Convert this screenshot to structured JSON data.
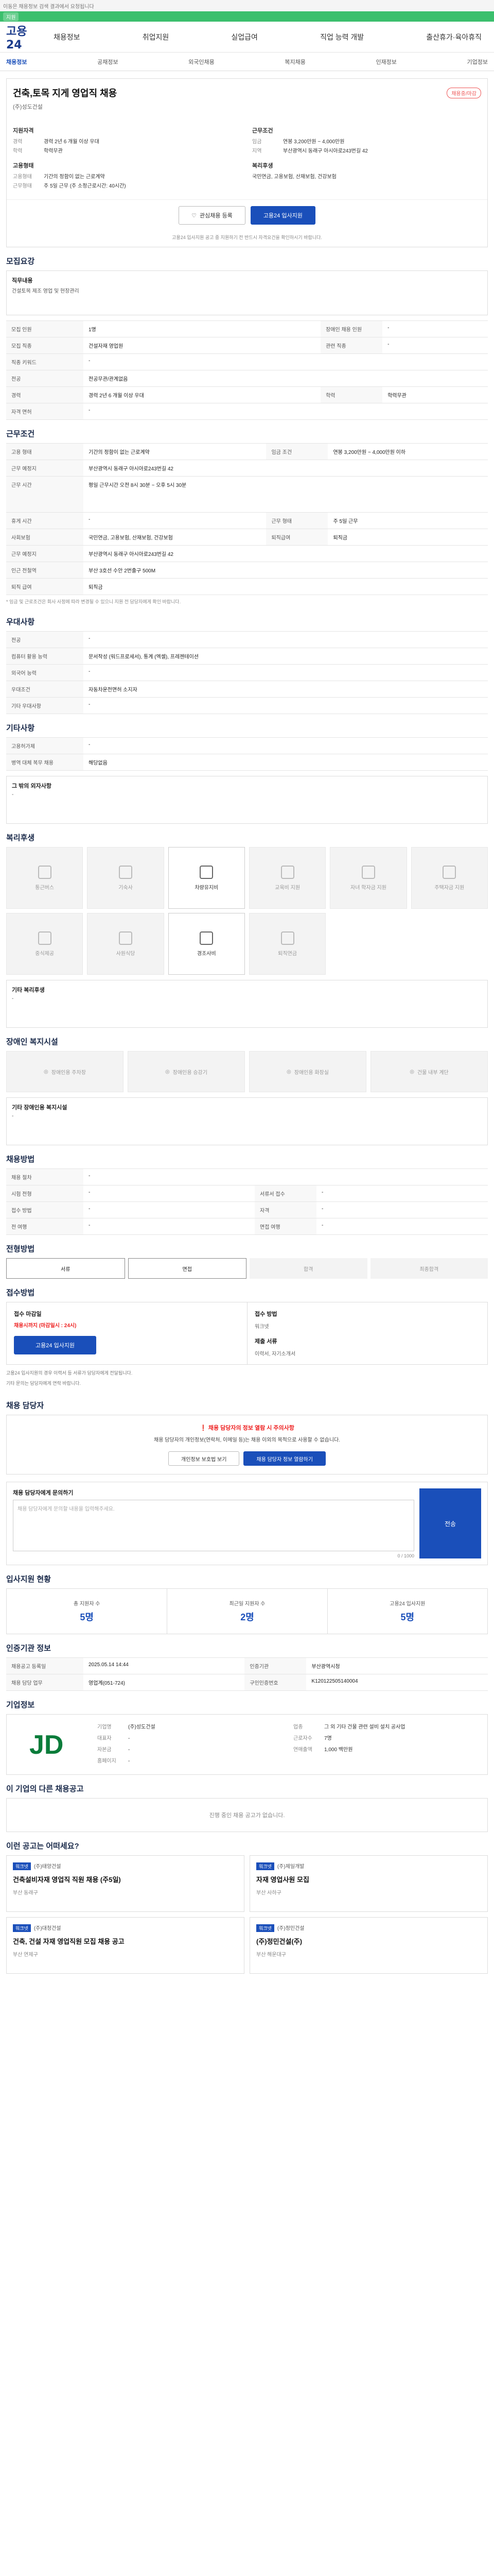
{
  "strip": {
    "text": "이동은 채용정보 검색 결과에서 요청됩니다",
    "active": "지원"
  },
  "header": {
    "logo": "고용24",
    "gnb": [
      "채용정보",
      "취업지원",
      "실업급여",
      "직업 능력 개발",
      "출산휴가·육아휴직"
    ]
  },
  "subnav": [
    "채용정보",
    "공채정보",
    "외국인채용",
    "복지채용",
    "인재정보",
    "기업정보"
  ],
  "job": {
    "title": "건축,토목 지게 영업직 채용",
    "badge": "채용중/마감",
    "company": "(주)성도건설",
    "summary_left_title": "지원자격",
    "summary_left": [
      {
        "k": "경력",
        "v": "경력 2년 6 개월 이상 우대"
      },
      {
        "k": "학력",
        "v": "학력무관"
      }
    ],
    "summary_right_title": "근무조건",
    "summary_right": [
      {
        "k": "임금",
        "v": "연봉 3,200만원 ~ 4,000만원"
      },
      {
        "k": "지역",
        "v": "부산광역시 동래구 아시아로243번길 42"
      }
    ],
    "summary_left2_title": "고용형태",
    "summary_left2": [
      {
        "k": "고용형태",
        "v": "기간의 정함이 없는 근로계약"
      },
      {
        "k": "근무형태",
        "v": "주 5일 근무 (주 소정근로시간: 40시간)"
      }
    ],
    "summary_right2_title": "복리후생",
    "summary_right2": [
      {
        "k": "",
        "v": "국민연금, 고용보험, 산재보험, 건강보험"
      }
    ],
    "btn_save": "관심채용 등록",
    "btn_apply": "고용24 입사지원",
    "apply_note": "고용24 입사지원 공고 중 지원하기 전 반드시 자격요건을 확인하시기 바랍니다."
  },
  "recruit": {
    "title": "모집요강",
    "job_label": "직무내용",
    "job_text": "건설토목 제조 영업 및 현장관리",
    "rows": [
      {
        "k": "모집 인원",
        "v": "1명",
        "k2": "장애인 채용 인원",
        "v2": "-"
      },
      {
        "k": "모집 직종",
        "v": "건설자재 영업원",
        "k2": "관련 직종",
        "v2": "-"
      },
      {
        "k": "직종 키워드",
        "v": "-",
        "k2": "",
        "v2": ""
      },
      {
        "k": "전공",
        "v": "전공무관/관계없음",
        "k2": "",
        "v2": ""
      },
      {
        "k": "경력",
        "v": "경력 2년 6 개월 이상 우대",
        "k2": "학력",
        "v2": "학력무관"
      },
      {
        "k": "자격 면허",
        "v": "-",
        "k2": "",
        "v2": ""
      }
    ]
  },
  "conditions": {
    "title": "근무조건",
    "rows": [
      {
        "k": "고용 형태",
        "v": "기간의 정함이 없는 근로계약",
        "k2": "임금 조건",
        "v2": "연봉 3,200만원 ~ 4,000만원 이하"
      },
      {
        "k": "근무 예정지",
        "v": "부산광역시 동래구 아시아로243번길 42",
        "k2": "",
        "v2": ""
      },
      {
        "k": "근무 시간",
        "v": "평일 근무시간 오전 8시 30분 ~ 오후 5시 30분",
        "k2": "",
        "v2": ""
      },
      {
        "k": "휴게 시간",
        "v": "-",
        "k2": "근무 형태",
        "v2": "주 5일 근무"
      },
      {
        "k": "사회보험",
        "v": "국민연금, 고용보험, 산재보험, 건강보험",
        "k2": "퇴직급여",
        "v2": "퇴직금"
      },
      {
        "k": "근무 예정지",
        "v": "부산광역시 동래구 아시아로243번길 42",
        "k2": "",
        "v2": ""
      },
      {
        "k": "인근 전철역",
        "v": "부산 3호선 수안 2번출구 500M",
        "k2": "",
        "v2": ""
      },
      {
        "k": "퇴직 급여",
        "v": "퇴직금",
        "k2": "",
        "v2": ""
      }
    ],
    "note": "* 임금 및 근로조건은 회사 사정에 따라 변경될 수 있으니 지원 전 담당자에게 확인 바랍니다."
  },
  "prefer": {
    "title": "우대사항",
    "rows": [
      {
        "k": "전공",
        "v": "-"
      },
      {
        "k": "컴퓨터 활용 능력",
        "v": "문서작성 (워드프로세서), 통계 (엑셀), 프레젠테이션"
      },
      {
        "k": "외국어 능력",
        "v": "-"
      },
      {
        "k": "우대조건",
        "v": "자동차운전면허 소지자"
      },
      {
        "k": "기타 우대사항",
        "v": "-"
      }
    ]
  },
  "etc": {
    "title": "기타사항",
    "rows": [
      {
        "k": "고용허가제",
        "v": "-"
      },
      {
        "k": "병역 대체 복무 채용",
        "v": "해당없음"
      }
    ],
    "extra_label": "그 밖의 외자사항",
    "extra_value": "-"
  },
  "welfare": {
    "title": "복리후생",
    "items": [
      {
        "label": "통근버스",
        "on": false
      },
      {
        "label": "기숙사",
        "on": false
      },
      {
        "label": "차량유지비",
        "on": true
      },
      {
        "label": "교육비 지원",
        "on": false
      },
      {
        "label": "자녀 학자금 지원",
        "on": false
      },
      {
        "label": "주택자금 지원",
        "on": false
      },
      {
        "label": "중식제공",
        "on": false
      },
      {
        "label": "사원식당",
        "on": false
      },
      {
        "label": "경조사비",
        "on": true
      },
      {
        "label": "퇴직연금",
        "on": false
      }
    ],
    "other_label": "기타 복리후생",
    "other_value": "-"
  },
  "disability": {
    "title": "장애인 복지시설",
    "items": [
      "장애인용 주차장",
      "장애인용 승강기",
      "장애인용 화장실",
      "건물 내부 계단"
    ],
    "other_label": "기타 장애인용 복지시설",
    "other_value": "-"
  },
  "selection": {
    "title": "채용방법",
    "rows": [
      {
        "k": "채용 절차",
        "v": "-",
        "k2": "",
        "v2": ""
      },
      {
        "k": "시험 전형",
        "v": "-",
        "k2": "서류서 접수",
        "v2": "-"
      },
      {
        "k": "접수 방법",
        "v": "-",
        "k2": "자격",
        "v2": "-"
      },
      {
        "k": "전 여행",
        "v": "-",
        "k2": "면접 여행",
        "v2": "-"
      }
    ]
  },
  "process": {
    "title": "전형방법",
    "steps": [
      "서류",
      "면접",
      "합격",
      "최종합격"
    ],
    "active": [
      0,
      1
    ]
  },
  "apply": {
    "title": "접수방법",
    "period_label": "접수 마감일",
    "period": "채용시까지 (마감일시 : 24시)",
    "method_label": "접수 방법",
    "method": "워크넷",
    "btn": "고용24 입사지원",
    "doc_label": "제출 서류",
    "doc": "이력서, 자기소개서",
    "notes": [
      "고용24 입사지원의 경우 이력서 등 서류가 담당자에게 전달됩니다.",
      "기타 문의는 담당자에게 연락 바랍니다."
    ]
  },
  "manager": {
    "title": "채용 담당자",
    "warn_title": "채용 담당자의 정보 열람 시 주의사항",
    "warn_text": "채용 담당자의 개인정보(연락처, 이메일 등)는 채용 이외의 목적으로 사용할 수 없습니다.",
    "btn1": "개인정보 보호법 보기",
    "btn2": "채용 담당자 정보 열람하기"
  },
  "qa": {
    "title": "채용 담당자에게 문의하기",
    "placeholder": "채용 담당자에게 문의할 내용을 입력해주세요.",
    "count": "0 / 1000",
    "btn": "전송"
  },
  "stats": {
    "title": "입사지원 현황",
    "items": [
      {
        "t": "총 지원자 수",
        "n": "5명"
      },
      {
        "t": "최근일 지원자 수",
        "n": "2명"
      },
      {
        "t": "고용24 입사지원",
        "n": "5명"
      }
    ]
  },
  "cert": {
    "title": "인증기관 정보",
    "rows": [
      {
        "k": "채용공고 등록일",
        "v": "2025.05.14 14:44",
        "k2": "인증기관",
        "v2": "부산광역시청"
      },
      {
        "k": "채용 담당 업무",
        "v": "영업계(051-724)",
        "k2": "구인인증번호",
        "v2": "K120122505140004"
      }
    ]
  },
  "company": {
    "title": "기업정보",
    "logo_text": "JD",
    "info": [
      {
        "k": "기업명",
        "v": "(주)성도건설"
      },
      {
        "k": "업종",
        "v": "그 외 기타 건물 관련 설비 설치 공사업"
      },
      {
        "k": "대표자",
        "v": "-"
      },
      {
        "k": "근로자수",
        "v": "7명"
      },
      {
        "k": "자본금",
        "v": "-"
      },
      {
        "k": "연매출액",
        "v": "1,000 백만원"
      },
      {
        "k": "홈페이지",
        "v": "-"
      }
    ]
  },
  "other_jobs": {
    "title": "이 기업의 다른 채용공고",
    "empty": "진행 중인 채용 공고가 없습니다."
  },
  "similar": {
    "title": "이런 공고는 어떠세요?",
    "jobs": [
      {
        "tag": "워크넷",
        "company": "(주)태양건설",
        "title": "건축설비자재 영업직 직원 채용 (주5일)",
        "loc": "부산 동래구"
      },
      {
        "tag": "워크넷",
        "company": "(주)제일개발",
        "title": "자재 영업사원 모집",
        "loc": "부산 사하구"
      },
      {
        "tag": "워크넷",
        "company": "(주)대청건설",
        "title": "건축, 건설 자재 영업직원 모집 채용 공고",
        "loc": "부산 연제구"
      },
      {
        "tag": "워크넷",
        "company": "(주)정민건설",
        "title": "(주)정민건설(주)",
        "loc": "부산 해운대구"
      }
    ]
  }
}
